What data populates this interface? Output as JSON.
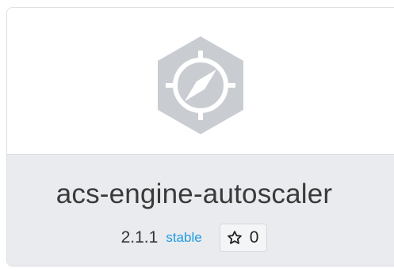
{
  "package": {
    "name": "acs-engine-autoscaler",
    "version": "2.1.1",
    "channel": "stable",
    "stars": "0",
    "logo_icon": "compass-hexagon-icon",
    "star_icon": "star-outline-icon"
  },
  "colors": {
    "channel": "#1e9ae0",
    "logo": "#c9cdd2",
    "footer_bg": "#e9ebee"
  }
}
